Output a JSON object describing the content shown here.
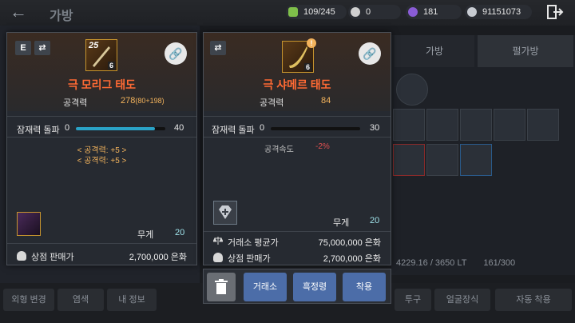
{
  "header": {
    "title": "가방",
    "currencies": [
      {
        "icon": "bag-capacity-icon",
        "value": "109/245",
        "color": "#7fbf4a"
      },
      {
        "icon": "pearl-icon",
        "value": "0",
        "color": "#d0d0d0"
      },
      {
        "icon": "purple-orb-icon",
        "value": "181",
        "color": "#8a5cd6"
      },
      {
        "icon": "silver-coin-icon",
        "value": "91151073",
        "color": "#c8ccd2"
      }
    ]
  },
  "background": {
    "tabs": [
      "가방",
      "펄가방"
    ],
    "weight_text": "4229.16 / 3650 LT",
    "slot_count": "161/300",
    "bottom_buttons": [
      "외형 변경",
      "염색",
      "내 정보",
      "투구",
      "얼굴장식",
      "자동 착용"
    ]
  },
  "left_card": {
    "chip_e": "E",
    "enhance_level": "25",
    "grade_badge": "6",
    "name": "극 모리그 태도",
    "stat_label": "공격력",
    "stat_value": "278",
    "stat_detail": "(80+198)",
    "potential_label": "잠재력 돌파",
    "potential_min": "0",
    "potential_max": "40",
    "potential_fill": 0.88,
    "options": [
      "< 공격력: +5 >",
      "< 공격력: +5 >"
    ],
    "weight_label": "무게",
    "weight_value": "20",
    "shop_label": "상점 판매가",
    "shop_value": "2,700,000 은화"
  },
  "right_card": {
    "grade_badge": "6",
    "name": "극 샤메르 태도",
    "stat_label": "공격력",
    "stat_value": "84",
    "potential_label": "잠재력 돌파",
    "potential_min": "0",
    "potential_max": "30",
    "potential_fill": 0.0,
    "speed_label": "공격속도",
    "speed_value": "-2%",
    "weight_label": "무게",
    "weight_value": "20",
    "market_label": "거래소 평균가",
    "market_value": "75,000,000 은화",
    "shop_label": "상점 판매가",
    "shop_value": "2,700,000 은화"
  },
  "actions": [
    "거래소",
    "흑정령",
    "착용"
  ],
  "colors": {
    "accent_blue": "#4c6da8",
    "name_orange": "#ff6a34",
    "stat_gold": "#f3b35c",
    "bar_cyan": "#2aa3c8"
  }
}
